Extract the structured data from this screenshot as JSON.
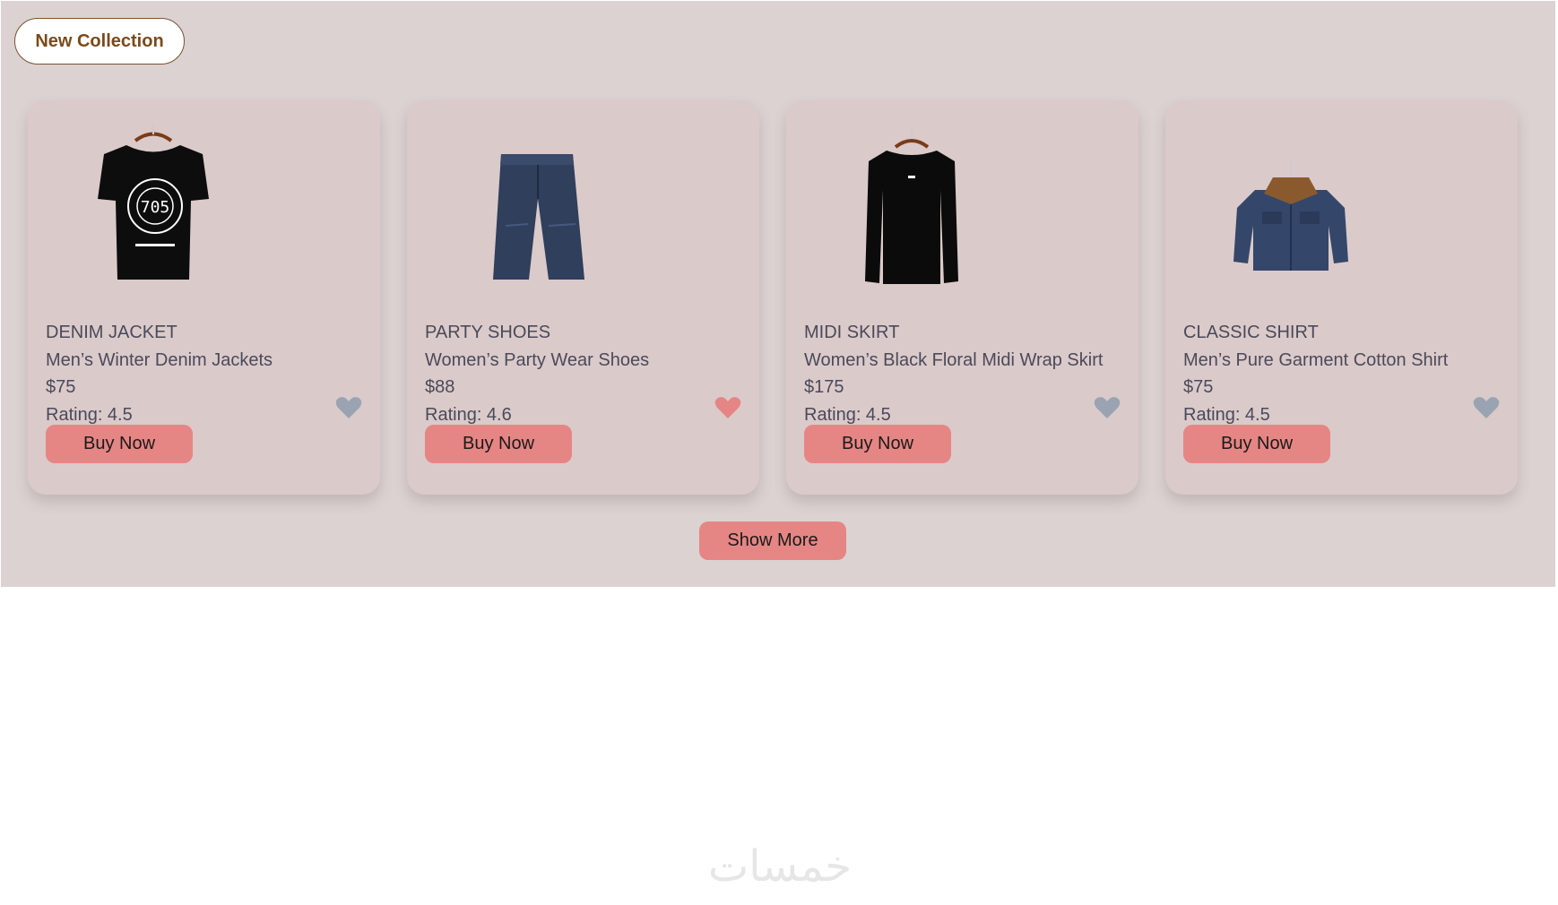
{
  "header": {
    "badge_label": "New Collection"
  },
  "products": [
    {
      "category": "DENIM JACKET",
      "name": "Men’s Winter Denim Jackets",
      "price": "$75",
      "rating": "Rating: 4.5",
      "favorite": false,
      "image_icon": "tshirt-icon",
      "buy_label": "Buy Now"
    },
    {
      "category": "PARTY SHOES",
      "name": "Women’s Party Wear Shoes",
      "price": "$88",
      "rating": "Rating: 4.6",
      "favorite": true,
      "image_icon": "jeans-icon",
      "buy_label": "Buy Now"
    },
    {
      "category": "MIDI SKIRT",
      "name": "Women’s Black Floral Midi Wrap Skirt",
      "price": "$175",
      "rating": "Rating: 4.5",
      "favorite": false,
      "image_icon": "longsleeve-icon",
      "buy_label": "Buy Now"
    },
    {
      "category": "CLASSIC SHIRT",
      "name": "Men’s Pure Garment Cotton Shirt",
      "price": "$75",
      "rating": "Rating: 4.5",
      "favorite": false,
      "image_icon": "denim-jacket-icon",
      "buy_label": "Buy Now"
    }
  ],
  "footer": {
    "show_more_label": "Show More"
  },
  "watermark": {
    "text": "خمسات"
  },
  "colors": {
    "section_bg": "#dcd2d2",
    "card_bg": "#dbcaca",
    "accent": "#e58684",
    "heart_on": "#e58684",
    "heart_off": "#9aa3b2"
  }
}
